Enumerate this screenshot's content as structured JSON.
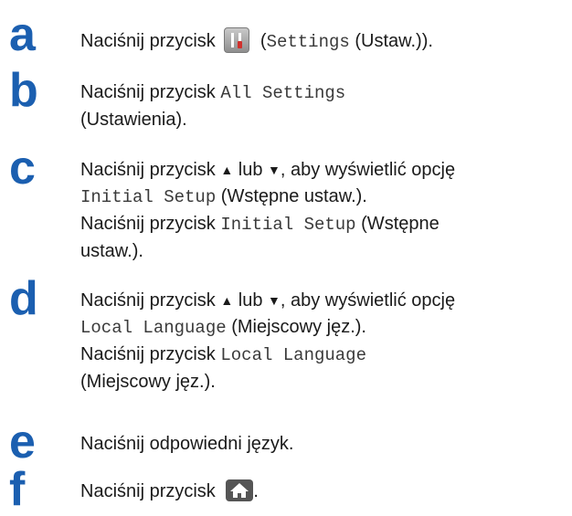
{
  "steps": [
    {
      "letter": "a",
      "segments": [
        {
          "t": "Naciśnij przycisk "
        },
        {
          "icon": "settings-icon"
        },
        {
          "t": "Settings",
          "mono": true,
          "pre": " ("
        },
        {
          "t": " (Ustaw.))."
        }
      ]
    },
    {
      "letter": "b",
      "lines": [
        [
          {
            "t": "Naciśnij przycisk "
          },
          {
            "t": "All Settings",
            "mono": true
          }
        ],
        [
          {
            "t": "(Ustawienia)."
          }
        ]
      ]
    },
    {
      "letter": "c",
      "lines": [
        [
          {
            "t": "Naciśnij przycisk "
          },
          {
            "t": "▲",
            "tri": true
          },
          {
            "t": " lub "
          },
          {
            "t": "▼",
            "tri": true
          },
          {
            "t": ", aby wyświetlić opcję"
          }
        ],
        [
          {
            "t": "Initial Setup",
            "mono": true
          },
          {
            "t": " (Wstępne ustaw.)."
          }
        ],
        [
          {
            "t": "Naciśnij przycisk "
          },
          {
            "t": "Initial Setup",
            "mono": true
          },
          {
            "t": " (Wstępne"
          }
        ],
        [
          {
            "t": "ustaw.)."
          }
        ]
      ]
    },
    {
      "letter": "d",
      "lines": [
        [
          {
            "t": "Naciśnij przycisk "
          },
          {
            "t": "▲",
            "tri": true
          },
          {
            "t": " lub "
          },
          {
            "t": "▼",
            "tri": true
          },
          {
            "t": ", aby wyświetlić opcję"
          }
        ],
        [
          {
            "t": "Local Language",
            "mono": true
          },
          {
            "t": " (Miejscowy jęz.)."
          }
        ],
        [
          {
            "t": "Naciśnij przycisk "
          },
          {
            "t": "Local Language",
            "mono": true
          }
        ],
        [
          {
            "t": "(Miejscowy jęz.)."
          }
        ]
      ]
    },
    {
      "letter": "e",
      "lines": [
        [
          {
            "t": "Naciśnij odpowiedni język."
          }
        ]
      ]
    },
    {
      "letter": "f",
      "lines": [
        [
          {
            "t": "Naciśnij przycisk "
          },
          {
            "icon": "home-icon"
          },
          {
            "t": "."
          }
        ]
      ]
    }
  ]
}
